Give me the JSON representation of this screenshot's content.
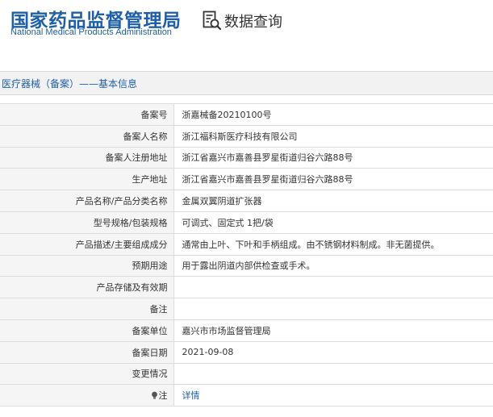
{
  "header": {
    "logo_cn": "国家药品监督管理局",
    "logo_en": "National Medical Products Administration",
    "query_label": "数据查询",
    "query_icon": "document-search-icon",
    "brand_color": "#1e5fa8"
  },
  "section": {
    "title": "医疗器械（备案）——基本信息"
  },
  "rows": [
    {
      "label": "备案号",
      "value": "浙嘉械备20210100号"
    },
    {
      "label": "备案人名称",
      "value": "浙江福科斯医疗科技有限公司"
    },
    {
      "label": "备案人注册地址",
      "value": "浙江省嘉兴市嘉善县罗星街道归谷六路88号"
    },
    {
      "label": "生产地址",
      "value": "浙江省嘉兴市嘉善县罗星街道归谷六路88号"
    },
    {
      "label": "产品名称/产品分类名称",
      "value": "金属双翼阴道扩张器"
    },
    {
      "label": "型号规格/包装规格",
      "value": "可调式、固定式 1把/袋"
    },
    {
      "label": "产品描述/主要组成成分",
      "value": "通常由上叶、下叶和手柄组成。由不锈钢材料制成。非无菌提供。"
    },
    {
      "label": "预期用途",
      "value": "用于露出阴道内部供检查或手术。"
    },
    {
      "label": "产品存储及有效期",
      "value": ""
    },
    {
      "label": "备注",
      "value": ""
    },
    {
      "label": "备案单位",
      "value": "嘉兴市市场监督管理局"
    },
    {
      "label": "备案日期",
      "value": "2021-09-08"
    },
    {
      "label": "变更情况",
      "value": ""
    }
  ],
  "note_row": {
    "label": "注",
    "icon": "lightbulb-icon",
    "link": "详情"
  }
}
